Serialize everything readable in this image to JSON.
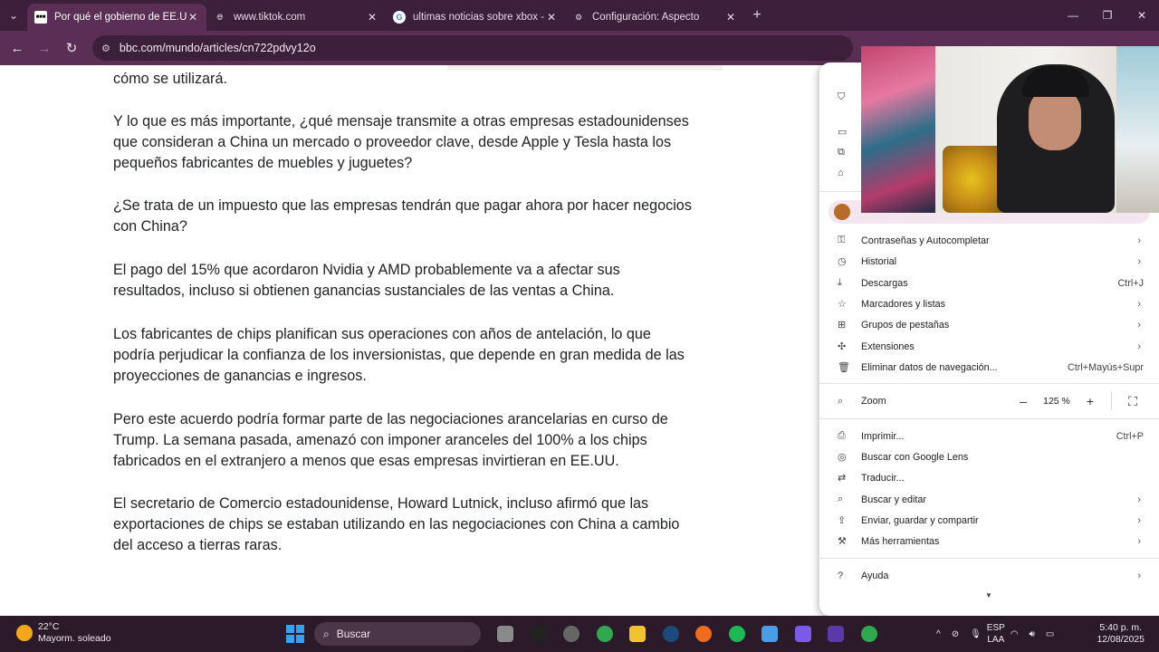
{
  "tabs": [
    {
      "title": "Por qué el gobierno de EE.UU. d",
      "favicon": "bbc-icon",
      "active": true
    },
    {
      "title": "www.tiktok.com",
      "favicon": "globe-icon",
      "active": false
    },
    {
      "title": "ultimas noticias sobre xbox - Bu",
      "favicon": "google-icon",
      "active": false
    },
    {
      "title": "Configuración: Aspecto",
      "favicon": "gear-icon",
      "active": false
    }
  ],
  "address_bar": {
    "url": "bbc.com/mundo/articles/cn722pdvy12o"
  },
  "article": {
    "paragraphs": [
      "cómo se utilizará.",
      "Y lo que es más importante, ¿qué mensaje transmite a otras empresas estadounidenses que consideran a China un mercado o proveedor clave, desde Apple y Tesla hasta los pequeños fabricantes de muebles y juguetes?",
      "¿Se trata de un impuesto que las empresas tendrán que pagar ahora por hacer negocios con China?",
      "El pago del 15% que acordaron Nvidia y AMD probablemente va a afectar sus resultados, incluso si obtienen ganancias sustanciales de las ventas a China.",
      "Los fabricantes de chips planifican sus operaciones con años de antelación, lo que podría perjudicar la confianza de los inversionistas, que depende en gran medida de las proyecciones de ganancias e ingresos.",
      "Pero este acuerdo podría formar parte de las negociaciones arancelarias en curso de Trump. La semana pasada, amenazó con imponer aranceles del 100% a los chips fabricados en el extranjero a menos que esas empresas invirtieran en EE.UU.",
      "El secretario de Comercio estadounidense, Howard Lutnick, incluso afirmó que las exportaciones de chips se estaban utilizando en las negociaciones con China a cambio del acceso a tierras raras."
    ]
  },
  "menu": {
    "items_group1": [
      {
        "label": "Contraseñas y Autocompletar",
        "shortcut": "",
        "submenu": true,
        "icon": "key-icon"
      },
      {
        "label": "Historial",
        "shortcut": "",
        "submenu": true,
        "icon": "history-icon"
      },
      {
        "label": "Descargas",
        "shortcut": "Ctrl+J",
        "submenu": false,
        "icon": "download-icon"
      },
      {
        "label": "Marcadores y listas",
        "shortcut": "",
        "submenu": true,
        "icon": "star-icon"
      },
      {
        "label": "Grupos de pestañas",
        "shortcut": "",
        "submenu": true,
        "icon": "grid-icon"
      },
      {
        "label": "Extensiones",
        "shortcut": "",
        "submenu": true,
        "icon": "puzzle-icon"
      },
      {
        "label": "Eliminar datos de navegación...",
        "shortcut": "Ctrl+Mayús+Supr",
        "submenu": false,
        "icon": "trash-icon"
      }
    ],
    "zoom": {
      "label": "Zoom",
      "minus": "–",
      "value": "125 %",
      "plus": "+"
    },
    "items_group2": [
      {
        "label": "Imprimir...",
        "shortcut": "Ctrl+P",
        "submenu": false,
        "icon": "print-icon"
      },
      {
        "label": "Buscar con Google Lens",
        "shortcut": "",
        "submenu": false,
        "icon": "lens-icon"
      },
      {
        "label": "Traducir...",
        "shortcut": "",
        "submenu": false,
        "icon": "translate-icon"
      },
      {
        "label": "Buscar y editar",
        "shortcut": "",
        "submenu": true,
        "icon": "find-icon"
      },
      {
        "label": "Enviar, guardar y compartir",
        "shortcut": "",
        "submenu": true,
        "icon": "share-icon"
      },
      {
        "label": "Más herramientas",
        "shortcut": "",
        "submenu": true,
        "icon": "toolbox-icon"
      }
    ],
    "items_group3": [
      {
        "label": "Ayuda",
        "shortcut": "",
        "submenu": true,
        "icon": "help-icon"
      }
    ]
  },
  "taskbar": {
    "weather_temp": "22°C",
    "weather_desc": "Mayorm. soleado",
    "search_label": "Buscar",
    "lang_top": "ESP",
    "lang_bottom": "LAA",
    "time": "5:40 p. m.",
    "date": "12/08/2025"
  }
}
